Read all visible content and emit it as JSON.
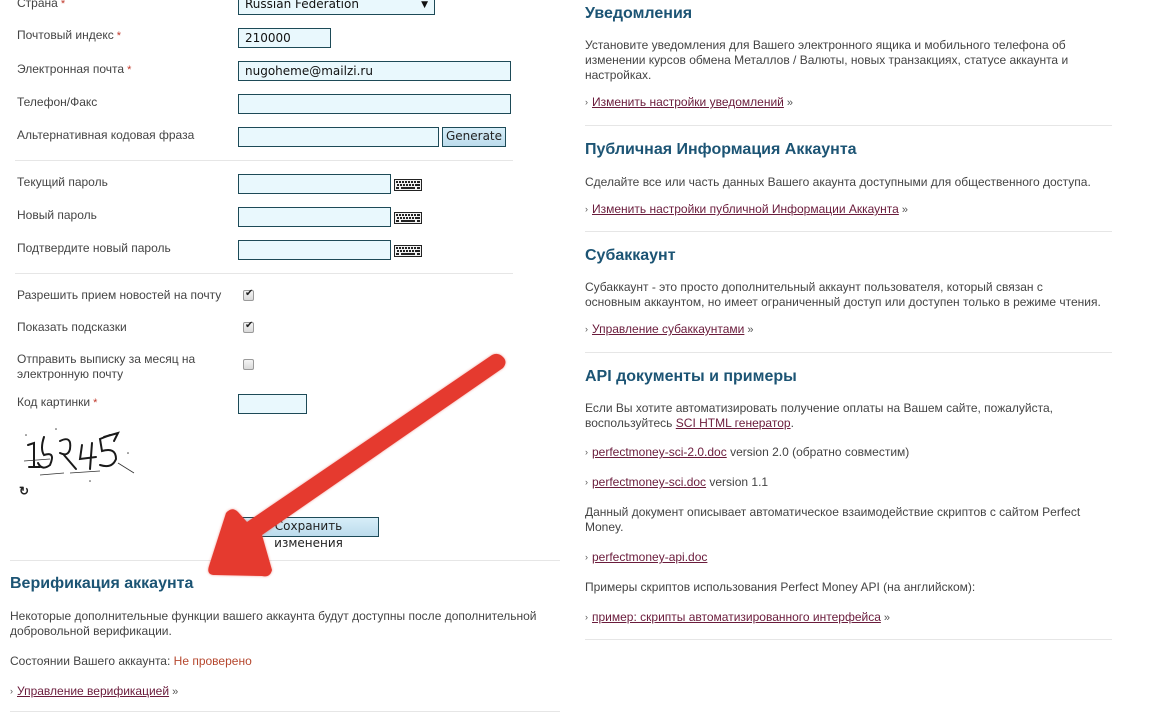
{
  "form": {
    "country": {
      "label": "Страна",
      "required_mark": "*",
      "value": "Russian Federation",
      "arrow": "▼"
    },
    "postal_code": {
      "label": "Почтовый индекс",
      "required_mark": "*",
      "value": "210000"
    },
    "email": {
      "label": "Электронная почта",
      "required_mark": "*",
      "value": "nugoheme@mailzi.ru"
    },
    "phone": {
      "label": "Телефон/Факс",
      "value": ""
    },
    "alt_passphrase": {
      "label": "Альтернативная кодовая фраза",
      "value": "",
      "generate_label": "Generate"
    },
    "current_password": {
      "label": "Текущий пароль",
      "value": "",
      "keyboard_icon": "virtual-keyboard-icon"
    },
    "new_password": {
      "label": "Новый пароль",
      "value": "",
      "keyboard_icon": "virtual-keyboard-icon"
    },
    "confirm_password": {
      "label": "Подтвердите новый пароль",
      "value": "",
      "keyboard_icon": "virtual-keyboard-icon"
    },
    "news_subscription": {
      "label": "Разрешить прием новостей на почту",
      "checked": true
    },
    "show_hints": {
      "label": "Показать подсказки",
      "checked": true
    },
    "monthly_statement": {
      "label_line1": "Отправить выписку за месяц на",
      "label_line2": "электронную почту",
      "checked": false
    },
    "captcha": {
      "label": "Код картинки",
      "required_mark": "*",
      "value": "",
      "image_text": "15345",
      "refresh_icon": "refresh-icon"
    },
    "save_label": "Сохранить изменения",
    "save_visible_label": "…нить изменения"
  },
  "verification": {
    "title": "Верификация аккаунта",
    "description_line1": "Некоторые дополнительные функции вашего аккаунта будут доступны после дополнительной",
    "description_line2": "добровольной верификации.",
    "status_label": "Состоянии Вашего аккаунта:",
    "status_value": "Не проверено",
    "link": "Управление верификацией",
    "link_suffix": "»"
  },
  "notifications": {
    "title": "Уведомления",
    "description_line1": "Установите уведомления для Вашего электронного ящика и мобильного телефона об",
    "description_line2": "изменении курсов обмена Металлов / Валюты, новых транзакциях, статусе аккаунта и",
    "description_line3": "настройках.",
    "link": "Изменить настройки уведомлений",
    "link_suffix": "»"
  },
  "public_info": {
    "title": "Публичная Информация Аккаунта",
    "description": "Сделайте все или часть данных Вашего акаунта доступными для общественного доступа.",
    "link": "Изменить настройки публичной Информации Аккаунта",
    "link_suffix": "»"
  },
  "subaccount": {
    "title": "Субаккаунт",
    "description_line1": "Субаккаунт - это просто дополнительный аккаунт пользователя, который связан с",
    "description_line2": "основным аккаунтом, но имеет ограниченный доступ или доступен только в режиме чтения.",
    "link": "Управление субаккаунтами",
    "link_suffix": "»"
  },
  "api": {
    "title": "API документы и примеры",
    "intro_line1": "Если Вы хотите автоматизировать получение оплаты на Вашем сайте, пожалуйста,",
    "intro_line2_prefix": "воспользуйтесь ",
    "intro_link": "SCI HTML генератор",
    "intro_line2_suffix": ".",
    "docs": [
      {
        "link": "perfectmoney-sci-2.0.doc",
        "note": " version 2.0 (обратно совместим)"
      },
      {
        "link": "perfectmoney-sci.doc",
        "note": " version 1.1"
      }
    ],
    "api_desc_line1": "Данный документ описывает автоматическое взаимодействие скриптов с сайтом Perfect",
    "api_desc_line2": "Money.",
    "api_doc_link": "perfectmoney-api.doc",
    "examples_label": "Примеры скриптов использования Perfect Money API (на английском):",
    "examples_link": "пример: скрипты автоматизированного интерфейса",
    "examples_suffix": "»"
  },
  "colors": {
    "heading": "#1c5474",
    "link": "#6a1b3b",
    "input_bg": "#e9f8fd",
    "input_border": "#1d4a57",
    "status_unverified": "#b5472e",
    "annotation_arrow": "#e53a2f"
  }
}
